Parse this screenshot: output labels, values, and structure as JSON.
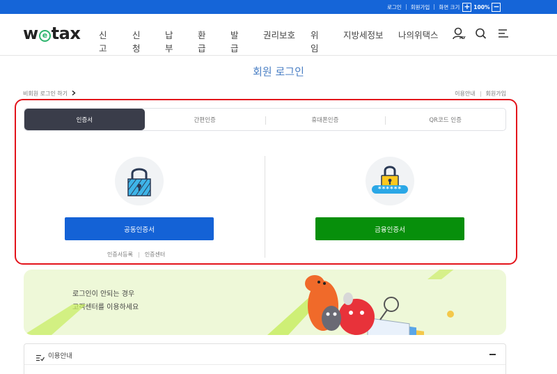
{
  "topbar": {
    "login": "로그인",
    "signup": "회원가입",
    "zoom_label": "화면 크기",
    "zoom_plus": "+",
    "zoom_value": "100%",
    "zoom_minus": "−"
  },
  "header": {
    "logo_w": "w",
    "logo_e": "e",
    "logo_tax": "tax",
    "nav": [
      "신고",
      "신청",
      "납부",
      "환급",
      "발급",
      "권리보호",
      "위임",
      "지방세정보",
      "나의위택스"
    ],
    "my_label": "MY"
  },
  "page": {
    "title": "회원 로그인",
    "nonmember_login": "비회원 로그인 하기",
    "usage_guide": "이용안내",
    "signup": "회원가입"
  },
  "tabs": [
    "인증서",
    "간편인증",
    "휴대폰인증",
    "QR코드 인증"
  ],
  "login": {
    "joint_cert_button": "공동인증서",
    "financial_cert_button": "금융인증서",
    "cert_register": "인증서등록",
    "cert_center": "인증센터",
    "password_mask": "******"
  },
  "banner": {
    "line1": "로그인이 안되는 경우",
    "line2": "고객센터를 이용하세요"
  },
  "accordion": {
    "title": "이용안내"
  },
  "colors": {
    "topbar": "#1565d8",
    "title": "#4a7fc4",
    "active_tab": "#3a3d4a",
    "joint_button": "#1462d6",
    "financial_button": "#078f0b",
    "highlight": "#e3131b",
    "banner_bg": "#eef8d8"
  }
}
